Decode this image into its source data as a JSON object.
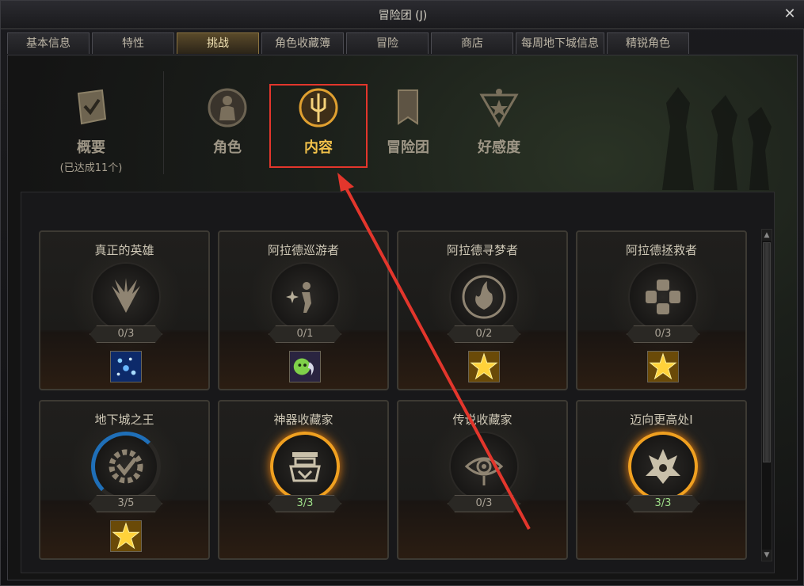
{
  "window": {
    "title": "冒险团 (J)",
    "close_icon": "close-icon"
  },
  "tabs": [
    {
      "label": "基本信息",
      "active": false
    },
    {
      "label": "特性",
      "active": false
    },
    {
      "label": "挑战",
      "active": true
    },
    {
      "label": "角色收藏簿",
      "active": false
    },
    {
      "label": "冒险",
      "active": false
    },
    {
      "label": "商店",
      "active": false
    },
    {
      "label": "每周地下城信息",
      "active": false
    },
    {
      "label": "精锐角色",
      "active": false
    }
  ],
  "categories": {
    "overview": {
      "label": "概要",
      "sub": "(已达成11个)",
      "icon": "checklist-scroll-icon"
    },
    "character": {
      "label": "角色",
      "icon": "character-silhouette-icon"
    },
    "content": {
      "label": "内容",
      "icon": "trident-emblem-icon",
      "active": true
    },
    "adventure_group": {
      "label": "冒险团",
      "icon": "banner-icon"
    },
    "affection": {
      "label": "好感度",
      "icon": "star-triangle-icon"
    }
  },
  "cards": [
    {
      "title": "真正的英雄",
      "progress": "0/3",
      "status": "none",
      "icon": "feather-wings-icon",
      "reward": "blue-sparkle-reward-icon"
    },
    {
      "title": "阿拉德巡游者",
      "progress": "0/1",
      "status": "none",
      "icon": "wanderer-icon",
      "reward": "green-ghost-reward-icon"
    },
    {
      "title": "阿拉德寻梦者",
      "progress": "0/2",
      "status": "none",
      "icon": "dream-flame-icon",
      "reward": "gold-star-reward-icon"
    },
    {
      "title": "阿拉德拯救者",
      "progress": "0/3",
      "status": "none",
      "icon": "savior-cross-icon",
      "reward": "gold-star-reward-icon"
    },
    {
      "title": "地下城之王",
      "progress": "3/5",
      "status": "partial",
      "icon": "gear-check-icon",
      "reward": "gold-star-reward-icon"
    },
    {
      "title": "神器收藏家",
      "progress": "3/3",
      "status": "complete",
      "icon": "artifact-chest-icon",
      "reward": null
    },
    {
      "title": "传说收藏家",
      "progress": "0/3",
      "status": "none",
      "icon": "legend-eye-icon",
      "reward": null
    },
    {
      "title": "迈向更高处I",
      "progress": "3/3",
      "status": "complete",
      "icon": "demon-crest-icon",
      "reward": null
    }
  ],
  "colors": {
    "highlight": "#e3362c",
    "accent_gold": "#f3c24a",
    "progress_blue": "#1f6fb8",
    "complete_orange": "#f0a020"
  }
}
